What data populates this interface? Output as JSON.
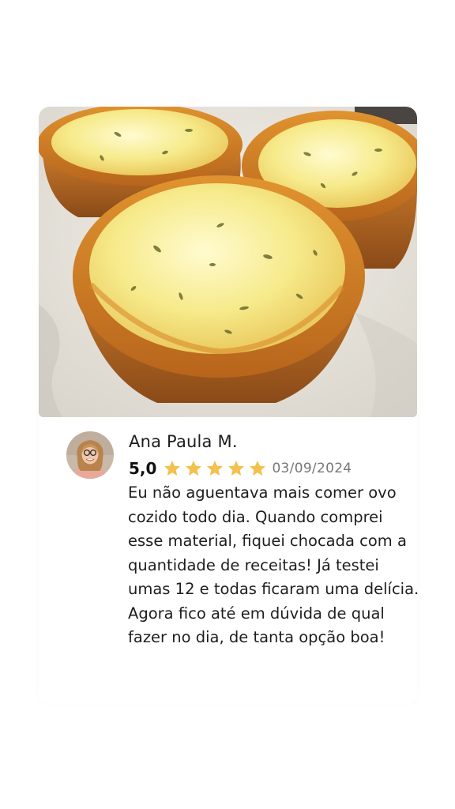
{
  "review": {
    "photo_icon": "quiche-tartlets-photo",
    "avatar_icon": "reviewer-avatar",
    "author": "Ana Paula M.",
    "score": "5,0",
    "stars": 5,
    "star_color": "#F2C14E",
    "date": "03/09/2024",
    "text": "Eu não aguentava mais comer ovo cozido todo dia. Quando comprei esse material, fiquei chocada com a quantidade de receitas! Já testei umas 12 e todas ficaram uma delícia. Agora fico até em dúvida de qual fazer no dia, de tanta opção boa!"
  }
}
